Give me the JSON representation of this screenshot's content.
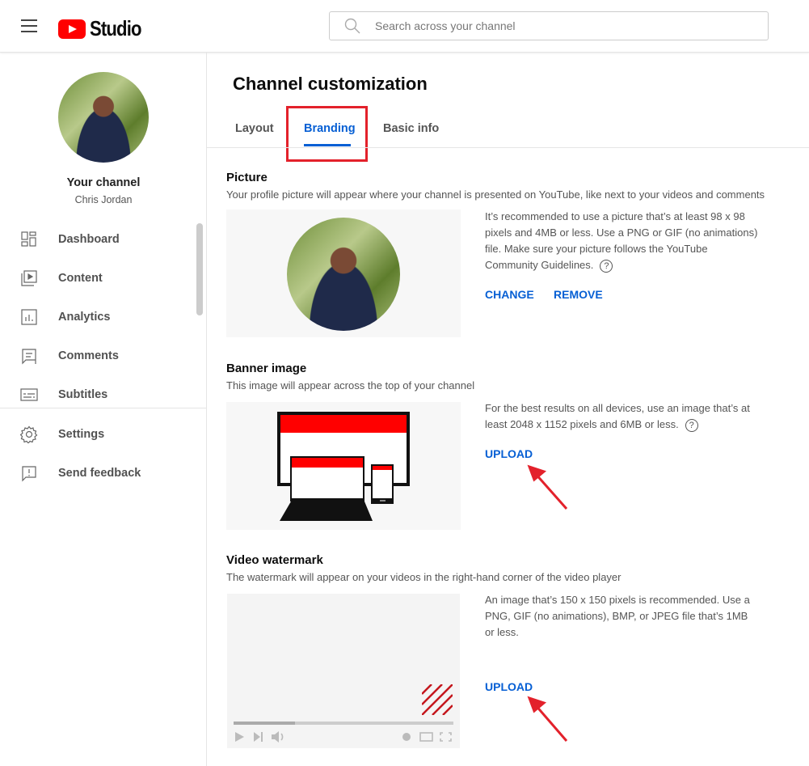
{
  "header": {
    "app_name": "Studio",
    "search_placeholder": "Search across your channel",
    "icons": [
      "menu-icon",
      "youtube-logo",
      "search-icon"
    ]
  },
  "sidebar": {
    "channel_label": "Your channel",
    "channel_name": "Chris Jordan",
    "items": [
      {
        "label": "Dashboard",
        "icon": "dashboard-icon"
      },
      {
        "label": "Content",
        "icon": "content-icon"
      },
      {
        "label": "Analytics",
        "icon": "analytics-icon"
      },
      {
        "label": "Comments",
        "icon": "comments-icon"
      },
      {
        "label": "Subtitles",
        "icon": "subtitles-icon"
      }
    ],
    "footer_items": [
      {
        "label": "Settings",
        "icon": "gear-icon"
      },
      {
        "label": "Send feedback",
        "icon": "feedback-icon"
      }
    ]
  },
  "main": {
    "title": "Channel customization",
    "tabs": [
      {
        "label": "Layout"
      },
      {
        "label": "Branding",
        "active": true
      },
      {
        "label": "Basic info"
      }
    ],
    "picture": {
      "heading": "Picture",
      "description": "Your profile picture will appear where your channel is presented on YouTube, like next to your videos and comments",
      "info": "It’s recommended to use a picture that’s at least 98 x 98 pixels and 4MB or less. Use a PNG or GIF (no animations) file. Make sure your picture follows the YouTube Community Guidelines.",
      "change_label": "CHANGE",
      "remove_label": "REMOVE"
    },
    "banner": {
      "heading": "Banner image",
      "description": "This image will appear across the top of your channel",
      "info": "For the best results on all devices, use an image that’s at least 2048 x 1152 pixels and 6MB or less.",
      "upload_label": "UPLOAD"
    },
    "watermark": {
      "heading": "Video watermark",
      "description": "The watermark will appear on your videos in the right-hand corner of the video player",
      "info": "An image that’s 150 x 150 pixels is recommended. Use a PNG, GIF (no animations), BMP, or JPEG file that’s 1MB or less.",
      "upload_label": "UPLOAD",
      "player_progress": 0.28
    }
  },
  "colors": {
    "accent": "#065fd4",
    "brand_red": "#ff0000",
    "highlight": "#e3212b",
    "arrow": "#e3212b"
  }
}
